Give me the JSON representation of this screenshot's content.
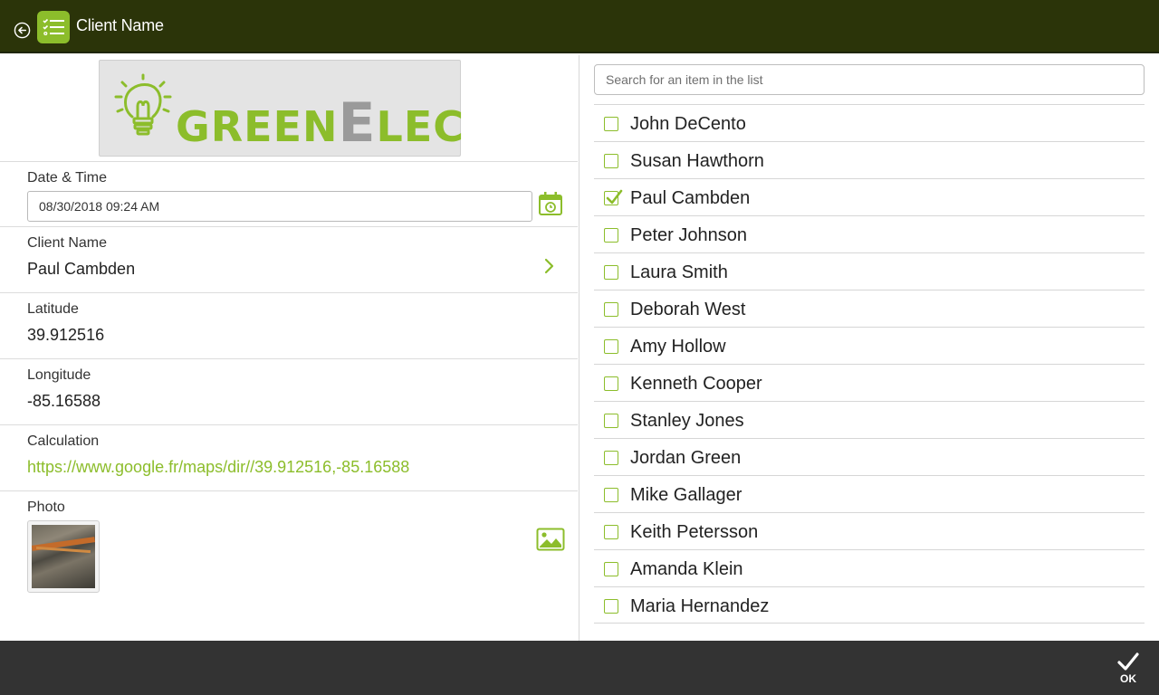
{
  "header": {
    "title": "Client Name"
  },
  "logo": {
    "part1": "GREEN",
    "part2": "E",
    "part3": "LEC"
  },
  "fields": {
    "datetime": {
      "label": "Date & Time",
      "value": "08/30/2018 09:24 AM"
    },
    "client": {
      "label": "Client Name",
      "value": "Paul Cambden"
    },
    "latitude": {
      "label": "Latitude",
      "value": "39.912516"
    },
    "longitude": {
      "label": "Longitude",
      "value": "-85.16588"
    },
    "calculation": {
      "label": "Calculation",
      "value": "https://www.google.fr/maps/dir//39.912516,-85.16588"
    },
    "photo": {
      "label": "Photo"
    }
  },
  "search": {
    "placeholder": "Search for an item in the list"
  },
  "list": [
    {
      "label": "John DeCento",
      "checked": false
    },
    {
      "label": "Susan Hawthorn",
      "checked": false
    },
    {
      "label": "Paul Cambden",
      "checked": true
    },
    {
      "label": "Peter Johnson",
      "checked": false
    },
    {
      "label": "Laura Smith",
      "checked": false
    },
    {
      "label": "Deborah West",
      "checked": false
    },
    {
      "label": "Amy Hollow",
      "checked": false
    },
    {
      "label": "Kenneth Cooper",
      "checked": false
    },
    {
      "label": "Stanley Jones",
      "checked": false
    },
    {
      "label": "Jordan Green",
      "checked": false
    },
    {
      "label": "Mike Gallager",
      "checked": false
    },
    {
      "label": "Keith Petersson",
      "checked": false
    },
    {
      "label": "Amanda Klein",
      "checked": false
    },
    {
      "label": "Maria Hernandez",
      "checked": false
    }
  ],
  "footer": {
    "ok_label": "OK"
  },
  "colors": {
    "accent": "#8cbd2b",
    "header_bg": "#2b3409",
    "footer_bg": "#333333"
  }
}
